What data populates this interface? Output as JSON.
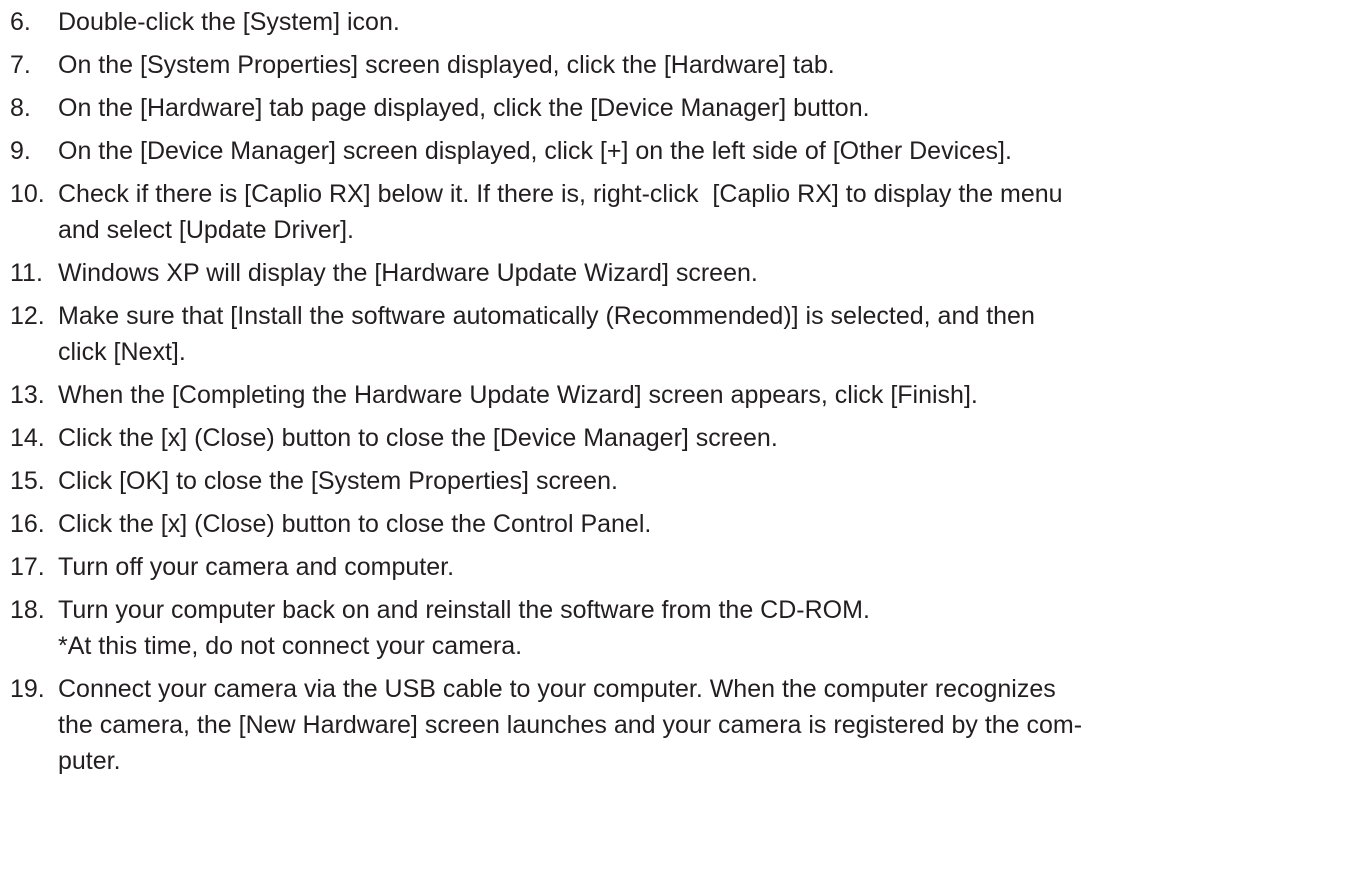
{
  "steps": [
    {
      "number": "6.",
      "lines": [
        "Double-click the [System] icon."
      ]
    },
    {
      "number": "7.",
      "lines": [
        "On the [System Properties] screen displayed, click the [Hardware] tab."
      ]
    },
    {
      "number": "8.",
      "lines": [
        "On the [Hardware] tab page displayed, click the [Device Manager] button."
      ]
    },
    {
      "number": "9.",
      "lines": [
        "On the [Device Manager] screen displayed, click [+] on the left side of [Other Devices]."
      ]
    },
    {
      "number": "10.",
      "lines": [
        "Check if there is [Caplio RX] below it. If there is, right-click  [Caplio RX] to display the menu",
        "and select [Update Driver]."
      ]
    },
    {
      "number": "11.",
      "lines": [
        "Windows XP will display the [Hardware Update Wizard] screen."
      ]
    },
    {
      "number": "12.",
      "lines": [
        "Make sure that [Install the software automatically (Recommended)] is selected, and then",
        "click [Next]."
      ]
    },
    {
      "number": "13.",
      "lines": [
        "When the [Completing the Hardware Update Wizard] screen appears, click [Finish]."
      ]
    },
    {
      "number": "14.",
      "lines": [
        "Click the [x] (Close) button to close the [Device Manager] screen."
      ]
    },
    {
      "number": "15.",
      "lines": [
        "Click [OK] to close the [System Properties] screen."
      ]
    },
    {
      "number": "16.",
      "lines": [
        "Click the [x] (Close) button to close the Control Panel."
      ]
    },
    {
      "number": "17.",
      "lines": [
        "Turn off your camera and computer."
      ]
    },
    {
      "number": "18.",
      "lines": [
        "Turn your computer back on and reinstall the software from the CD-ROM.",
        "*At this time, do not connect your camera."
      ]
    },
    {
      "number": "19.",
      "lines": [
        "Connect your camera via the USB cable to your computer. When the computer recognizes",
        "the camera, the [New Hardware] screen launches and your camera is registered by the com-",
        "puter."
      ]
    }
  ]
}
